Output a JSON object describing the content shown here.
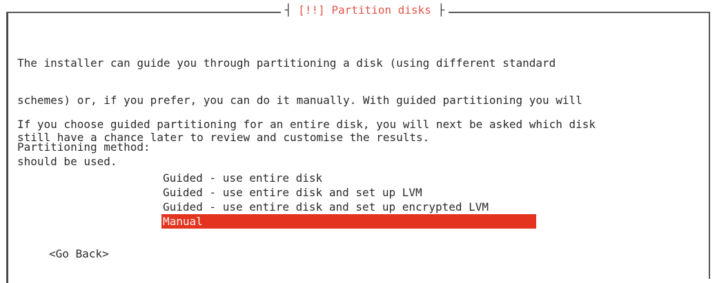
{
  "dialog": {
    "title": "[!!] Partition disks",
    "intro_lines": [
      "The installer can guide you through partitioning a disk (using different standard",
      "schemes) or, if you prefer, you can do it manually. With guided partitioning you will",
      "still have a chance later to review and customise the results."
    ],
    "guided_lines": [
      "If you choose guided partitioning for an entire disk, you will next be asked which disk",
      "should be used."
    ],
    "method_label": "Partitioning method:",
    "options": [
      {
        "label": "Guided - use entire disk",
        "selected": false
      },
      {
        "label": "Guided - use entire disk and set up LVM",
        "selected": false
      },
      {
        "label": "Guided - use entire disk and set up encrypted LVM",
        "selected": false
      },
      {
        "label": "Manual",
        "selected": true
      }
    ],
    "go_back_label": "<Go Back>"
  },
  "colors": {
    "selection_background": "#e4341f",
    "title_color": "#e0554a"
  }
}
